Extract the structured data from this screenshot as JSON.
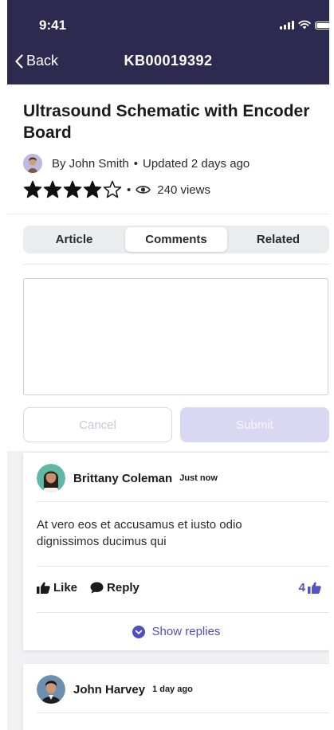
{
  "status_bar": {
    "time": "9:41"
  },
  "nav": {
    "back_label": "Back",
    "title": "KB00019392"
  },
  "article": {
    "title": "Ultrasound Schematic with Encoder Board",
    "author": "By John Smith",
    "separator": "•",
    "updated": "Updated 2 days ago",
    "rating": 4,
    "rating_max": 5,
    "views": "240 views"
  },
  "tabs": [
    {
      "label": "Article",
      "active": false
    },
    {
      "label": "Comments",
      "active": true
    },
    {
      "label": "Related",
      "active": false
    }
  ],
  "composer": {
    "value": "",
    "placeholder": "",
    "cancel_label": "Cancel",
    "submit_label": "Submit"
  },
  "comments": [
    {
      "author": "Brittany Coleman",
      "time": "Just now",
      "text": "At vero eos et accusamus et iusto odio dignissimos ducimus qui",
      "like_label": "Like",
      "reply_label": "Reply",
      "like_count": "4",
      "show_replies_label": "Show replies"
    },
    {
      "author": "John Harvey",
      "time": "1 day ago"
    }
  ],
  "colors": {
    "header_bg": "#2c2a4f",
    "accent": "#5353c6",
    "submit_disabled": "#d9d8f2",
    "feed_bg": "#f1f1f4"
  },
  "icons": {
    "back": "chevron-left-icon",
    "star": "star-icon",
    "views": "eye-icon",
    "like": "thumbs-up-icon",
    "reply": "speech-bubble-icon",
    "show_replies": "chevron-down-circle-icon"
  }
}
